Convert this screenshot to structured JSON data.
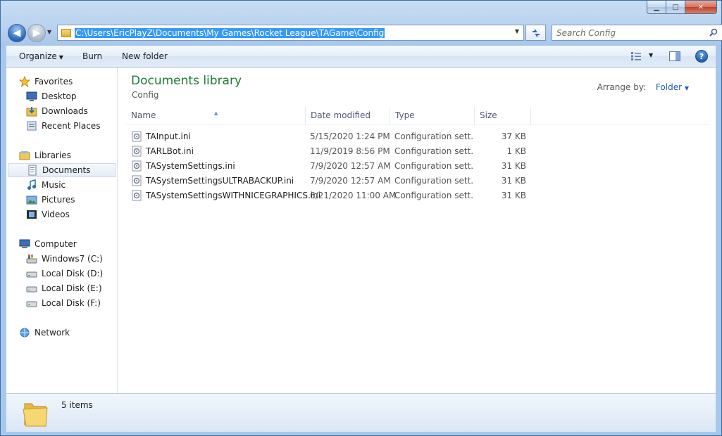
{
  "window": {
    "minimize": "▁",
    "maximize": "□",
    "close": "✕"
  },
  "navigation": {
    "back": "◀",
    "forward": "▶",
    "address_path": "C:\\Users\\EricPlayZ\\Documents\\My Games\\Rocket League\\TAGame\\Config",
    "search_placeholder": "Search Config"
  },
  "toolbar": {
    "organize_label": "Organize",
    "burn_label": "Burn",
    "new_folder_label": "New folder",
    "help_label": "?"
  },
  "sidebar": {
    "favorites": [
      {
        "label": "Favorites",
        "icon": "star-icon"
      },
      {
        "label": "Desktop",
        "icon": "desktop-icon"
      },
      {
        "label": "Downloads",
        "icon": "downloads-icon"
      },
      {
        "label": "Recent Places",
        "icon": "recent-places-icon"
      }
    ],
    "libraries": [
      {
        "label": "Libraries",
        "icon": "libraries-icon"
      },
      {
        "label": "Documents",
        "icon": "documents-icon",
        "selected": true
      },
      {
        "label": "Music",
        "icon": "music-icon"
      },
      {
        "label": "Pictures",
        "icon": "pictures-icon"
      },
      {
        "label": "Videos",
        "icon": "videos-icon"
      }
    ],
    "computer": [
      {
        "label": "Computer",
        "icon": "computer-icon"
      },
      {
        "label": "Windows7 (C:)",
        "icon": "system-drive-icon"
      },
      {
        "label": "Local Disk (D:)",
        "icon": "drive-icon"
      },
      {
        "label": "Local Disk (E:)",
        "icon": "drive-icon"
      },
      {
        "label": "Local Disk (F:)",
        "icon": "drive-icon"
      }
    ],
    "network": [
      {
        "label": "Network",
        "icon": "network-icon"
      }
    ]
  },
  "library": {
    "title": "Documents library",
    "subtitle": "Config",
    "arrange_label": "Arrange by:",
    "arrange_value": "Folder"
  },
  "columns": {
    "name": "Name",
    "date": "Date modified",
    "type": "Type",
    "size": "Size"
  },
  "files": [
    {
      "name": "TAInput.ini",
      "date": "5/15/2020 1:24 PM",
      "type": "Configuration sett...",
      "size": "37 KB"
    },
    {
      "name": "TARLBot.ini",
      "date": "11/9/2019 8:56 PM",
      "type": "Configuration sett...",
      "size": "1 KB"
    },
    {
      "name": "TASystemSettings.ini",
      "date": "7/9/2020 12:57 AM",
      "type": "Configuration sett...",
      "size": "31 KB"
    },
    {
      "name": "TASystemSettingsULTRABACKUP.ini",
      "date": "7/9/2020 12:57 AM",
      "type": "Configuration sett...",
      "size": "31 KB"
    },
    {
      "name": "TASystemSettingsWITHNICEGRAPHICS.ini",
      "date": "6/21/2020 11:00 AM",
      "type": "Configuration sett...",
      "size": "31 KB"
    }
  ],
  "details": {
    "item_count": "5 items"
  },
  "colors": {
    "accent": "#3399ff",
    "library_title": "#1e7b34",
    "link": "#1e5cb3"
  }
}
